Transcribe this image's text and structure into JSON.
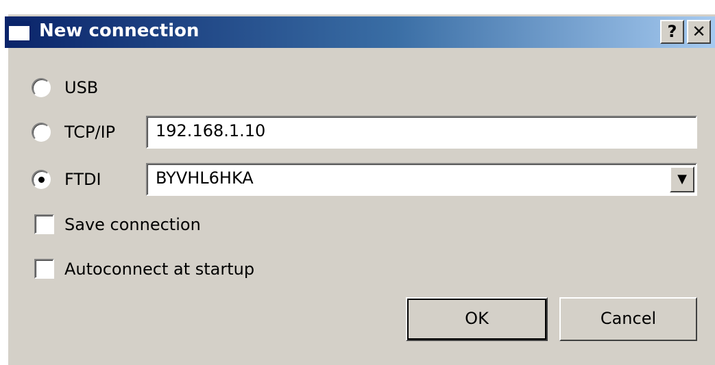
{
  "window": {
    "title": "New connection",
    "help_label": "?",
    "close_label": "✕"
  },
  "connection": {
    "usb_label": "USB",
    "tcp_label": "TCP/IP",
    "tcp_value": "192.168.1.10",
    "ftdi_label": "FTDI",
    "ftdi_value": "BYVHL6HKA",
    "selected": "FTDI"
  },
  "options": {
    "save_label": "Save connection",
    "save_checked": false,
    "autoconnect_label": "Autoconnect at startup",
    "autoconnect_checked": false
  },
  "buttons": {
    "ok": "OK",
    "cancel": "Cancel"
  }
}
